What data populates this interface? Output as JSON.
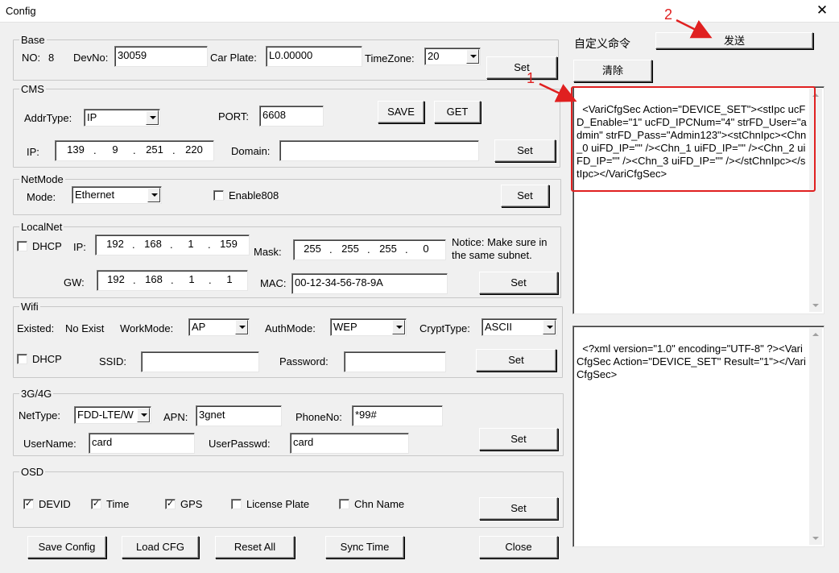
{
  "window": {
    "title": "Config"
  },
  "base": {
    "legend": "Base",
    "no_label": "NO:",
    "no_value": "8",
    "devno_label": "DevNo:",
    "devno_value": "30059",
    "carplate_label": "Car Plate:",
    "carplate_value": "L0.00000",
    "timezone_label": "TimeZone:",
    "timezone_value": "20",
    "set": "Set"
  },
  "cms": {
    "legend": "CMS",
    "addrtype_label": "AddrType:",
    "addrtype_value": "IP",
    "port_label": "PORT:",
    "port_value": "6608",
    "save": "SAVE",
    "get": "GET",
    "ip_label": "IP:",
    "ip": [
      "139",
      "9",
      "251",
      "220"
    ],
    "domain_label": "Domain:",
    "domain_value": "",
    "set": "Set"
  },
  "netmode": {
    "legend": "NetMode",
    "mode_label": "Mode:",
    "mode_value": "Ethernet",
    "enable808_label": "Enable808",
    "enable808_checked": false,
    "set": "Set"
  },
  "localnet": {
    "legend": "LocalNet",
    "dhcp_label": "DHCP",
    "dhcp_checked": false,
    "ip_label": "IP:",
    "ip": [
      "192",
      "168",
      "1",
      "159"
    ],
    "mask_label": "Mask:",
    "mask": [
      "255",
      "255",
      "255",
      "0"
    ],
    "notice_line1": "Notice: Make sure in",
    "notice_line2": "the same subnet.",
    "gw_label": "GW:",
    "gw": [
      "192",
      "168",
      "1",
      "1"
    ],
    "mac_label": "MAC:",
    "mac_value": "00-12-34-56-78-9A",
    "set": "Set"
  },
  "wifi": {
    "legend": "Wifi",
    "existed_label": "Existed:",
    "existed_value": "No Exist",
    "workmode_label": "WorkMode:",
    "workmode_value": "AP",
    "authmode_label": "AuthMode:",
    "authmode_value": "WEP",
    "crypttype_label": "CryptType:",
    "crypttype_value": "ASCII",
    "dhcp_label": "DHCP",
    "dhcp_checked": false,
    "ssid_label": "SSID:",
    "ssid_value": "",
    "password_label": "Password:",
    "password_value": "",
    "set": "Set"
  },
  "g4": {
    "legend": "3G/4G",
    "nettype_label": "NetType:",
    "nettype_value": "FDD-LTE/W",
    "apn_label": "APN:",
    "apn_value": "3gnet",
    "phoneno_label": "PhoneNo:",
    "phoneno_value": "*99#",
    "username_label": "UserName:",
    "username_value": "card",
    "userpasswd_label": "UserPasswd:",
    "userpasswd_value": "card",
    "set": "Set"
  },
  "osd": {
    "legend": "OSD",
    "devid": "DEVID",
    "time": "Time",
    "gps": "GPS",
    "license": "License Plate",
    "chn": "Chn Name",
    "check_mark": "✓",
    "set": "Set"
  },
  "bottom": {
    "save_config": "Save Config",
    "load_cfg": "Load CFG",
    "reset_all": "Reset All",
    "sync_time": "Sync Time",
    "close": "Close"
  },
  "custom": {
    "label": "自定义命令",
    "send": "发送",
    "clear": "清除",
    "command_text": "<VariCfgSec Action=\"DEVICE_SET\"><stIpc ucFD_Enable=\"1\" ucFD_IPCNum=\"4\" strFD_User=\"admin\" strFD_Pass=\"Admin123\"><stChnIpc><Chn_0 uiFD_IP=\"\" /><Chn_1 uiFD_IP=\"\" /><Chn_2 uiFD_IP=\"\" /><Chn_3 uiFD_IP=\"\" /></stChnIpc></stIpc></VariCfgSec>",
    "response_text": "<?xml version=\"1.0\" encoding=\"UTF-8\" ?><VariCfgSec Action=\"DEVICE_SET\" Result=\"1\"></VariCfgSec>"
  },
  "annotations": {
    "marker1": "1",
    "marker2": "2",
    "color": "#e02020"
  }
}
